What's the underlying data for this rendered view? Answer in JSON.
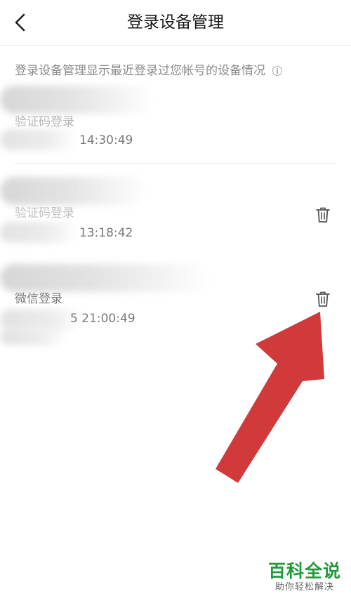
{
  "header": {
    "title": "登录设备管理",
    "back_icon": "chevron-left-icon"
  },
  "notice": {
    "text": "登录设备管理显示最近登录过您帐号的设备情况",
    "icon": "info-icon"
  },
  "devices": [
    {
      "method": "验证码登录",
      "time": "14:30:49",
      "deletable": false
    },
    {
      "method": "验证码登录",
      "time": "13:18:42",
      "deletable": true
    },
    {
      "method": "微信登录",
      "time": "5 21:00:49",
      "deletable": true
    }
  ],
  "annotation": {
    "arrow_color": "#d03a3a",
    "points_to": "delete button of third device"
  },
  "watermark": {
    "main": "百科全说",
    "sub": "助你轻松解决",
    "color": "#1f9a3a"
  }
}
